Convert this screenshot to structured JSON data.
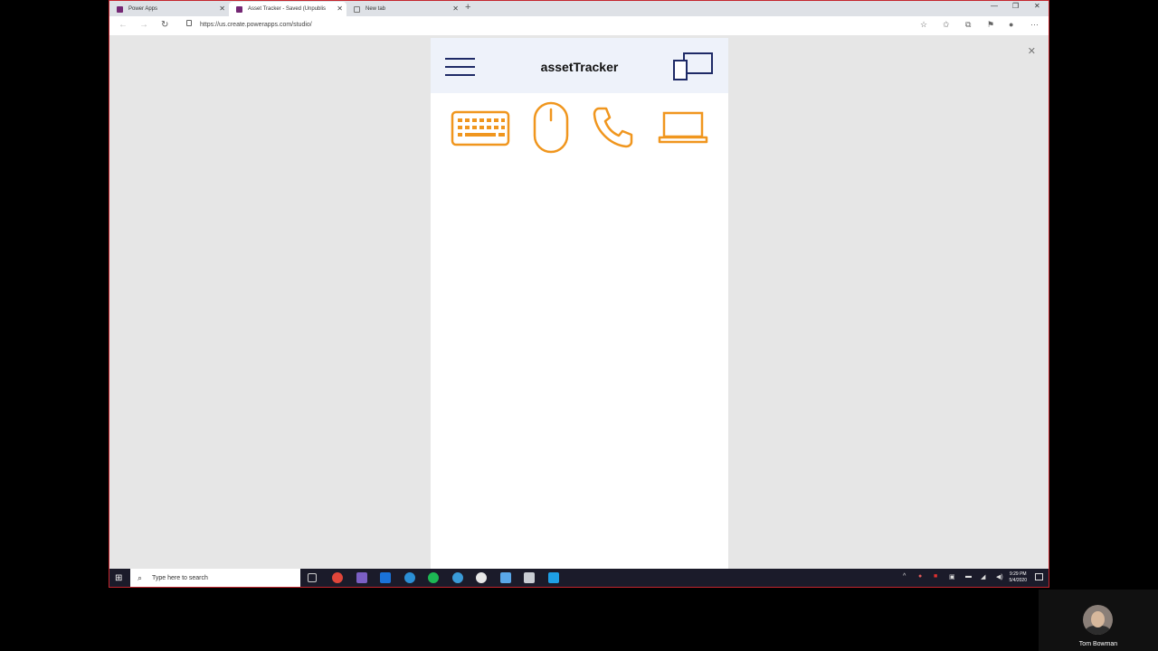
{
  "browser": {
    "tabs": [
      {
        "label": "Power Apps",
        "icon_color": "#742774"
      },
      {
        "label": "Asset Tracker - Saved (Unpublis",
        "icon_color": "#742774"
      },
      {
        "label": "New tab",
        "icon_color": "#777777"
      }
    ],
    "new_tab_symbol": "+",
    "url": "https://us.create.powerapps.com/studio/"
  },
  "app": {
    "title": "assetTracker",
    "header_color": "#1e2a66",
    "icon_color": "#f0961e",
    "asset_icons": [
      "keyboard-icon",
      "mouse-icon",
      "phone-icon",
      "laptop-icon"
    ]
  },
  "taskbar": {
    "search_placeholder": "Type here to search",
    "time": "9:29 PM",
    "date": "5/4/2020"
  },
  "webcam": {
    "name": "Tom Bowman"
  }
}
